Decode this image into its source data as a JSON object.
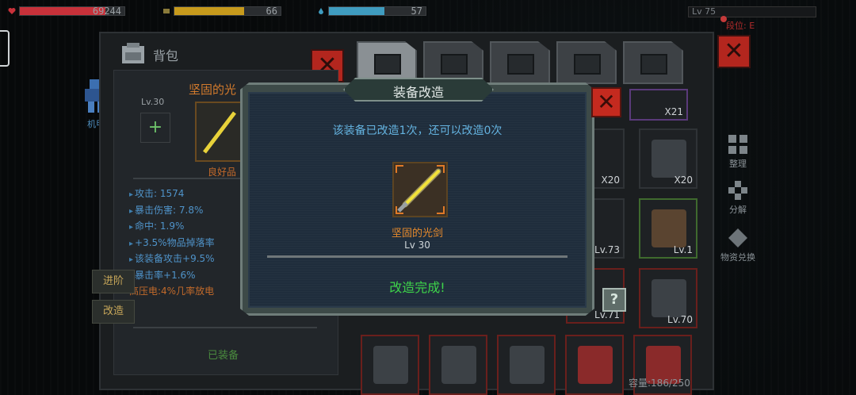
{
  "hud": {
    "hp_value": "69244",
    "food_value": "66",
    "water_value": "57",
    "level_label": "Lv 75",
    "rank_label": "段位: E",
    "hp_fill": 0.82,
    "food_fill": 0.66,
    "water_fill": 0.57,
    "colors": {
      "hp": "#c8313a",
      "food": "#c79a1c",
      "water": "#3f9cc0"
    }
  },
  "left_nav": {
    "mech_label": "机甲"
  },
  "side_menu": {
    "sort_label": "整理",
    "decompose_label": "分解",
    "exchange_label": "物资兑换"
  },
  "inventory": {
    "title": "背包",
    "capacity": "容量:186/250"
  },
  "item_panel": {
    "name": "坚固的光",
    "level": "Lv.30",
    "quality": "良好品",
    "stats": [
      "攻击: 1574",
      "暴击伤害: 7.8%",
      "命中: 1.9%",
      "+3.5%物品掉落率",
      "该装备攻击+9.5%",
      "暴击率+1.6%"
    ],
    "special": "高压电:4%几率放电",
    "advance_button": "进阶",
    "modify_button": "改造",
    "equipped_label": "已装备"
  },
  "grid": {
    "counts": [
      "X21",
      "X20",
      "X20",
      "Lv.73",
      "Lv.1",
      "Lv.70",
      "Lv.71"
    ]
  },
  "modal": {
    "title": "装备改造",
    "message": "该装备已改造1次，还可以改造0次",
    "item_name": "坚固的光剑",
    "item_level": "Lv 30",
    "result": "改造完成!",
    "close_symbol": "✕",
    "help_symbol": "?"
  }
}
